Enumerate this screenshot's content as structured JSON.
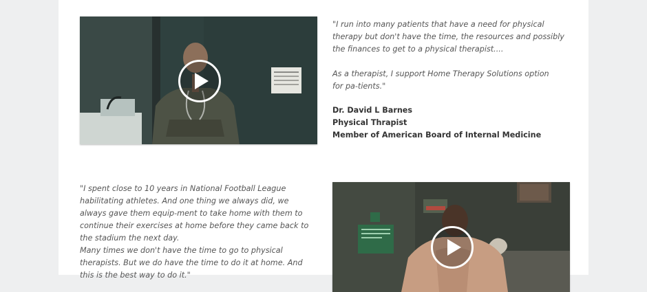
{
  "testimonials": [
    {
      "video": {
        "play_label": "Play video",
        "poster_sign": "Information on Treatment"
      },
      "quote_paragraphs": [
        "\"I run into many patients that have a need for physical therapy but don't have the time, the resources and possibly the finances to get to a physical therapist....",
        "As a therapist, I support Home Therapy Solutions option for pa-tients.\""
      ],
      "author": {
        "name": "Dr. David L Barnes",
        "title": "Physical Thrapist",
        "affiliation": "Member of American Board of Internal Medicine"
      }
    },
    {
      "video": {
        "play_label": "Play video"
      },
      "quote_paragraphs": [
        "\"I spent close to 10 years in National Football League habilitating athletes. And one thing we always did, we always gave them equip-ment to take home with them to continue their exercises at home before they came back to the stadium the next day.",
        "Many times we don't have the time to go to physical therapists. But we do have the time to do it at home. And this is the best way to do it.\""
      ]
    }
  ],
  "colors": {
    "page_background": "#eeeff0",
    "panel_background": "#ffffff",
    "quote_text": "#555555",
    "credit_text": "#333333"
  }
}
